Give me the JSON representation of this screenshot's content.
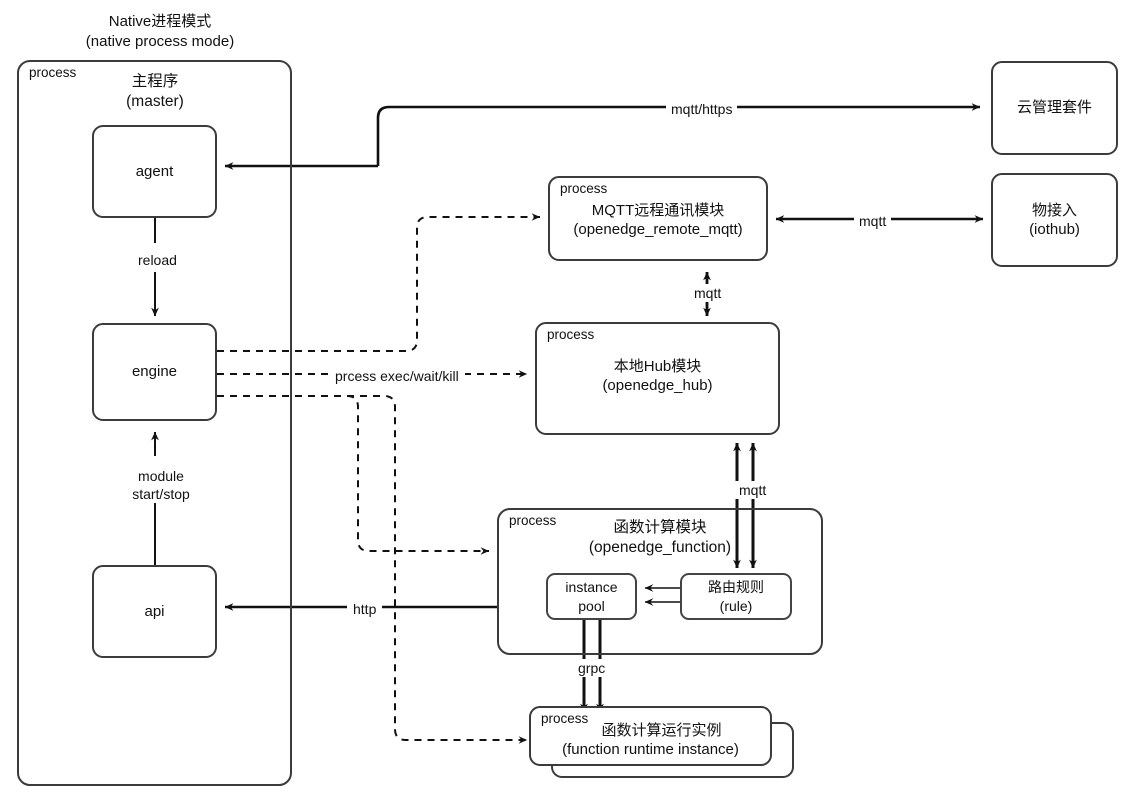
{
  "diagram": {
    "heading": {
      "line1": "Native进程模式",
      "line2": "(native process mode)"
    },
    "master_group": {
      "process_tag": "process",
      "title_cn": "主程序",
      "title_en": "(master)"
    },
    "nodes": {
      "agent": {
        "label": "agent"
      },
      "engine": {
        "label": "engine"
      },
      "api": {
        "label": "api"
      },
      "cloud_suite": {
        "label": "云管理套件"
      },
      "iothub": {
        "label_cn": "物接入",
        "label_en": "(iothub)"
      },
      "mqtt_remote": {
        "process_tag": "process",
        "label_cn": "MQTT远程通讯模块",
        "label_en": "(openedge_remote_mqtt)"
      },
      "local_hub": {
        "process_tag": "process",
        "label_cn": "本地Hub模块",
        "label_en": "(openedge_hub)"
      },
      "function_module": {
        "process_tag": "process",
        "label_cn": "函数计算模块",
        "label_en": "(openedge_function)"
      },
      "instance_pool": {
        "line1": "instance",
        "line2": "pool"
      },
      "rule": {
        "label_cn": "路由规则",
        "label_en": "(rule)"
      },
      "runtime_instance": {
        "process_tag": "process",
        "label_cn": "函数计算运行实例",
        "label_en": "(function runtime instance)"
      }
    },
    "edge_labels": {
      "mqtt_https": "mqtt/https",
      "mqtt_iothub": "mqtt",
      "mqtt_hub_remote": "mqtt",
      "mqtt_hub_function": "mqtt",
      "reload": "reload",
      "module_start_stop_l1": "module",
      "module_start_stop_l2": "start/stop",
      "process_exec": "prcess exec/wait/kill",
      "http": "http",
      "grpc": "grpc"
    },
    "colors": {
      "stroke": "#3b3b3b",
      "line": "#111111",
      "background": "#ffffff"
    }
  }
}
